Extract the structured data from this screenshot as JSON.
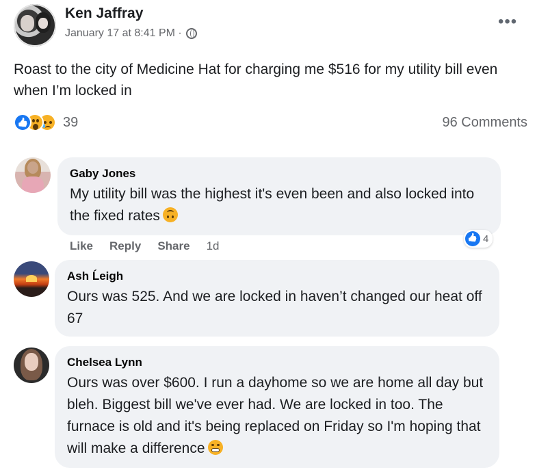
{
  "post": {
    "author": "Ken Jaffray",
    "timestamp": "January 17 at 8:41 PM ·",
    "privacy_icon": "globe-icon",
    "more_icon": "•••",
    "text": "Roast to the city of Medicine Hat for charging me $516 for my utility bill even when I’m locked in",
    "reaction_count": "39",
    "comments_count": "96 Comments"
  },
  "comments": [
    {
      "name": "Gaby Jones",
      "text": "My utility bill was the highest it's even been and also locked into the fixed rates",
      "emoji": "upside-down-face",
      "like_label": "Like",
      "reply_label": "Reply",
      "share_label": "Share",
      "time": "1d",
      "reaction_count": "4"
    },
    {
      "name": "Ash Ĺeigh",
      "text": "Ours was 525. And we are locked in haven’t changed our heat off 67"
    },
    {
      "name": "Chelsea Lynn",
      "text": "Ours was over $600. I run a dayhome so we are home all day but bleh. Biggest bill we've ever had. We are locked in too. The furnace is old and it's being replaced on Friday so I'm hoping that will make a difference",
      "emoji": "grimacing-face"
    }
  ],
  "colors": {
    "accent": "#1877f2",
    "bubble": "#f0f2f5",
    "secondary_text": "#65676b"
  }
}
